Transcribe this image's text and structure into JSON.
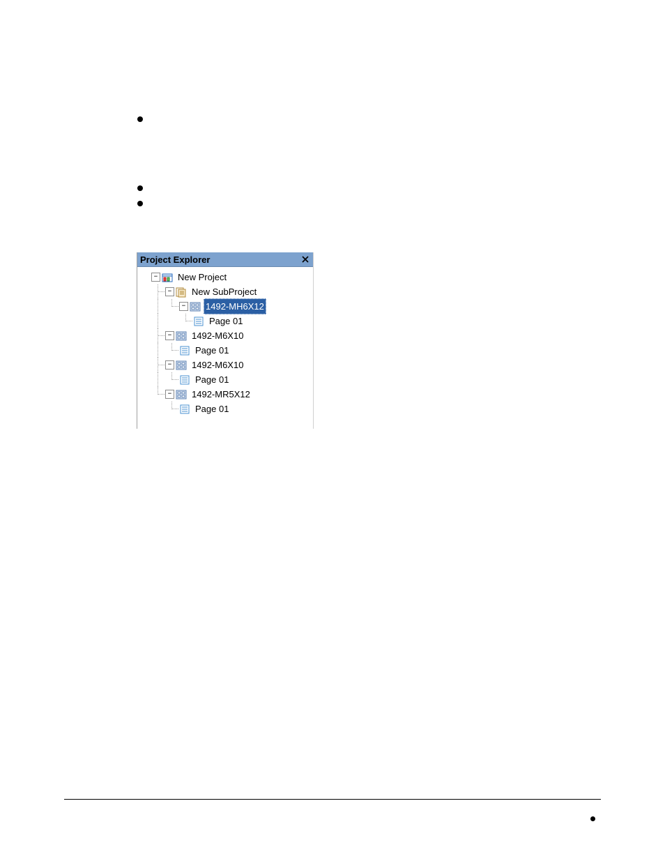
{
  "panel": {
    "title": "Project Explorer"
  },
  "tree": {
    "project": {
      "label": "New Project",
      "subproject": {
        "label": "New SubProject",
        "card": {
          "label": "1492-MH6X12",
          "page": "Page 01"
        }
      },
      "cards": [
        {
          "label": "1492-M6X10",
          "page": "Page 01"
        },
        {
          "label": "1492-M6X10",
          "page": "Page 01"
        },
        {
          "label": "1492-MR5X12",
          "page": "Page 01"
        }
      ]
    }
  }
}
